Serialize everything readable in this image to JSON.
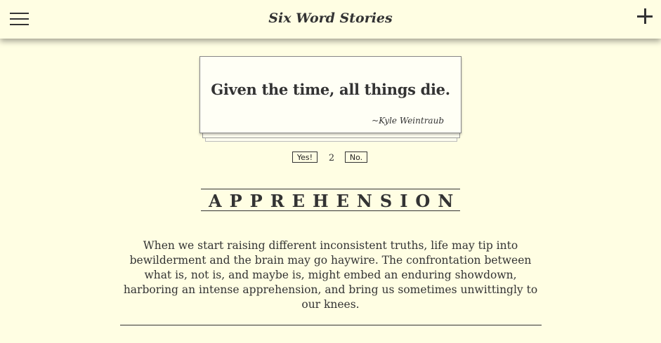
{
  "header": {
    "title": "Six Word Stories",
    "menu_icon": "hamburger-menu-icon",
    "add_icon": "plus-icon"
  },
  "story": {
    "text": "Given the time, all things die.",
    "author": "~Kyle Weintraub"
  },
  "voting": {
    "yes_label": "Yes!",
    "count": "2",
    "no_label": "No."
  },
  "word": {
    "heading": "APPREHENSION",
    "paragraph": "When we start raising different inconsistent truths, life may tip into bewilderment and the brain may go haywire. The confrontation between what is, not is, and maybe is, might embed an enduring showdown, harboring an intense apprehension, and bring us sometimes unwittingly to our knees."
  },
  "colors": {
    "background": "#fffee3",
    "text": "#333333"
  }
}
